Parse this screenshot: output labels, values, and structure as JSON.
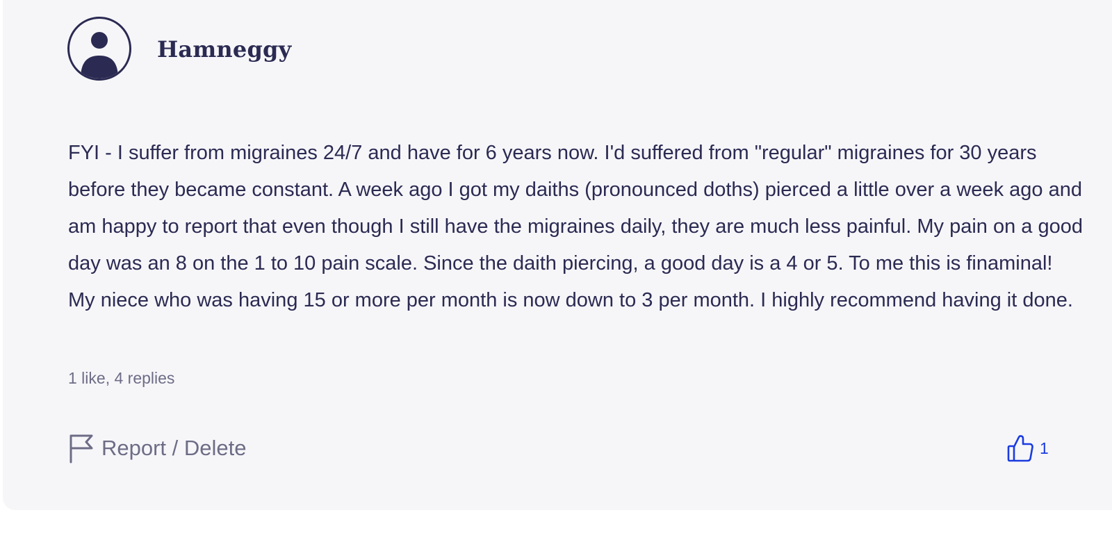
{
  "post": {
    "author": "Hamneggy",
    "avatar_icon": "user-avatar-icon",
    "body": "FYI - I suffer from migraines 24/7 and have for 6 years now. I'd suffered from \"regular\" migraines for 30 years before they became constant. A week ago I got my daiths (pronounced doths) pierced a little over a week ago and am happy to report that even though I still have the migraines daily, they are much less painful. My pain on a good day was an 8 on the 1 to 10 pain scale. Since the daith piercing, a good day is a 4 or 5. To me this is finaminal! My niece who was having 15 or more per month is now down to 3 per month. I highly recommend having it done.",
    "meta": "1 like, 4 replies"
  },
  "actions": {
    "report_label": "Report / Delete",
    "report_icon": "flag-icon",
    "like_icon": "thumbs-up-icon",
    "like_count": "1"
  },
  "colors": {
    "card_background": "#f6f6f9",
    "text": "#2b2a52",
    "muted": "#6d6c86",
    "accent": "#1a3be0"
  }
}
